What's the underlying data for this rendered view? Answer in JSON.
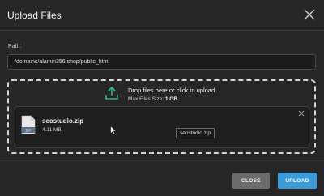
{
  "modal": {
    "title": "Upload Files"
  },
  "path": {
    "label": "Path:",
    "value": "/domains/alamin356.shop/public_html"
  },
  "dropzone": {
    "text": "Drop files here or click to upload",
    "max_label": "Max Files Size:",
    "max_value": "1 GB"
  },
  "file": {
    "name": "seostudio.zip",
    "size": "4.11 MB",
    "type_badge": "ZIP",
    "tooltip": "seostudio.zip"
  },
  "buttons": {
    "close": "CLOSE",
    "upload": "UPLOAD"
  },
  "colors": {
    "accent": "#3b9bd9",
    "upload_icon": "#2fb58e",
    "background": "#262626"
  },
  "icons": {
    "close": "close-icon",
    "upload": "upload-arrow-icon",
    "file": "zip-file-icon",
    "remove": "remove-icon",
    "cursor": "mouse-cursor-icon"
  }
}
